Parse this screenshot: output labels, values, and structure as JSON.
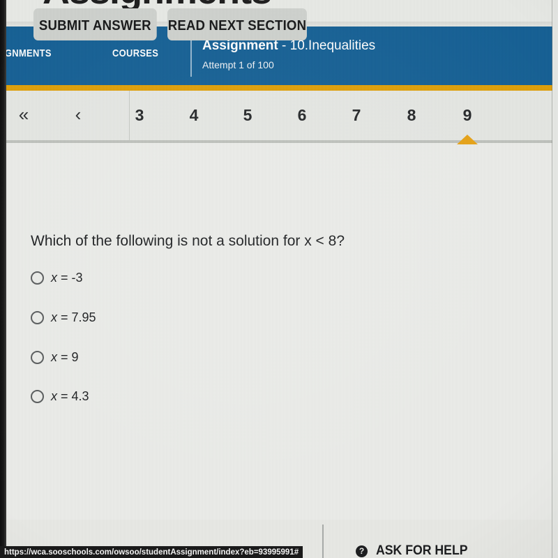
{
  "browser": {
    "status_url": "https://wca.sooschools.com/owsoo/studentAssignment/index?eb=93995991#"
  },
  "top_strip": {
    "clipped_title": "Assignments"
  },
  "header": {
    "nav_assignments": "IGNMENTS",
    "nav_courses": "COURSES",
    "assignment_label": "Assignment",
    "assignment_name": " - 10.Inequalities",
    "attempt": "Attempt 1 of 100",
    "bg_color": "#156095",
    "accent_color": "#e0a008"
  },
  "pager": {
    "first_icon": "«",
    "prev_icon": "‹",
    "pages": [
      "3",
      "4",
      "5",
      "6",
      "7",
      "8",
      "9"
    ],
    "active_page": "9",
    "marker_color": "#e8a317"
  },
  "question": {
    "prompt": "Which of the following is not a solution for x < 8?",
    "options": [
      {
        "var": "x",
        "rest": " = -3"
      },
      {
        "var": "x",
        "rest": " = 7.95"
      },
      {
        "var": "x",
        "rest": " = 9"
      },
      {
        "var": "x",
        "rest": " = 4.3"
      }
    ]
  },
  "footer": {
    "submit_label": "SUBMIT ANSWER",
    "read_next_label": "READ NEXT SECTION",
    "help_icon": "?",
    "help_label": "ASK FOR HELP"
  }
}
